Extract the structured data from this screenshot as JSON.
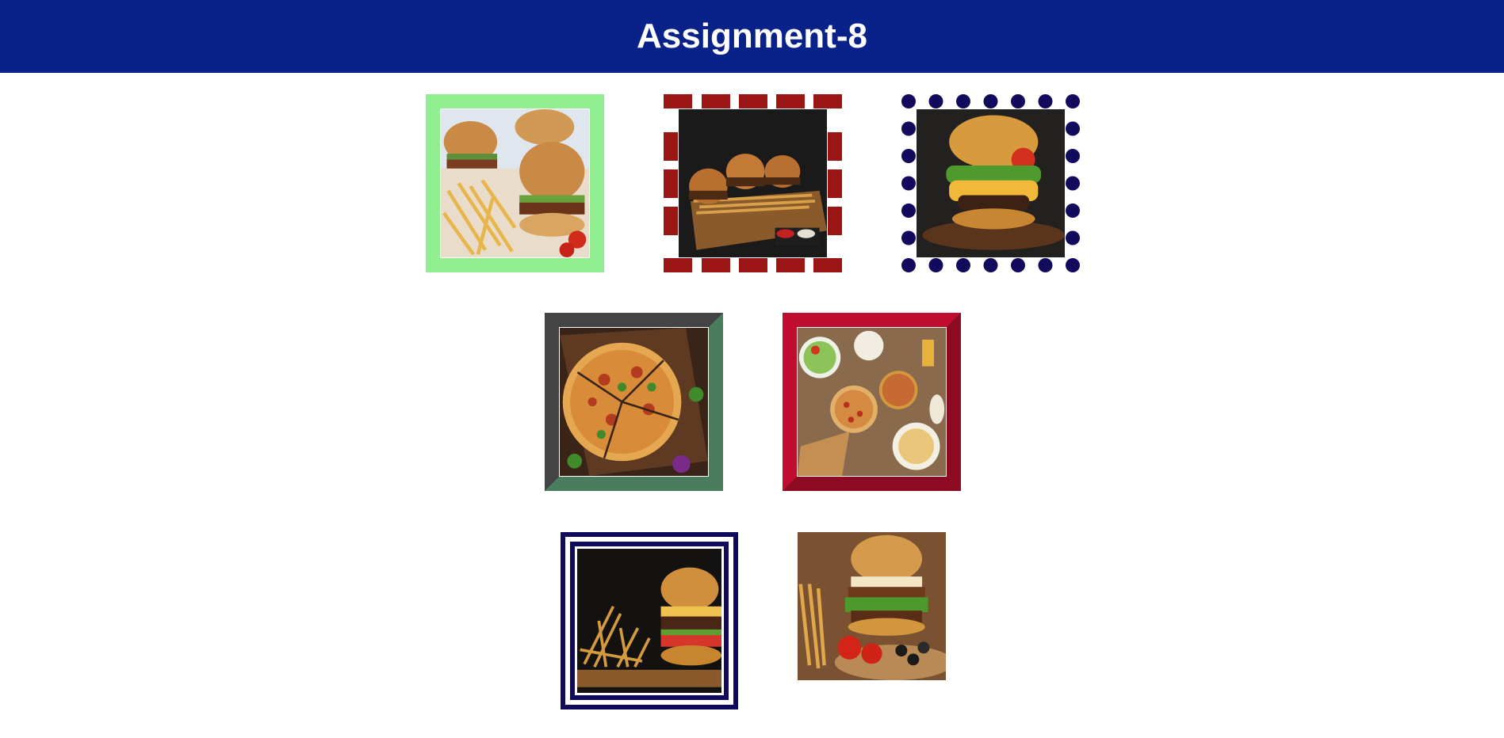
{
  "header": {
    "title": "Assignment-8",
    "background": "#08228a"
  },
  "gallery": {
    "images": [
      {
        "subject": "burgers-and-fries",
        "border_style": "solid",
        "border_color": "#90ee90"
      },
      {
        "subject": "slider-tray",
        "border_style": "dashed",
        "border_color": "#9b1515"
      },
      {
        "subject": "cheeseburger",
        "border_style": "dotted",
        "border_color": "#120a5c"
      },
      {
        "subject": "pizza-board",
        "border_style": "inset",
        "border_color": "#4a7d5e"
      },
      {
        "subject": "pizza-table",
        "border_style": "outset",
        "border_color": "#c00c2e"
      },
      {
        "subject": "burger-with-fries",
        "border_style": "double",
        "border_color": "#0f0a5c"
      },
      {
        "subject": "loaded-burger",
        "border_style": "none",
        "border_color": ""
      }
    ]
  }
}
